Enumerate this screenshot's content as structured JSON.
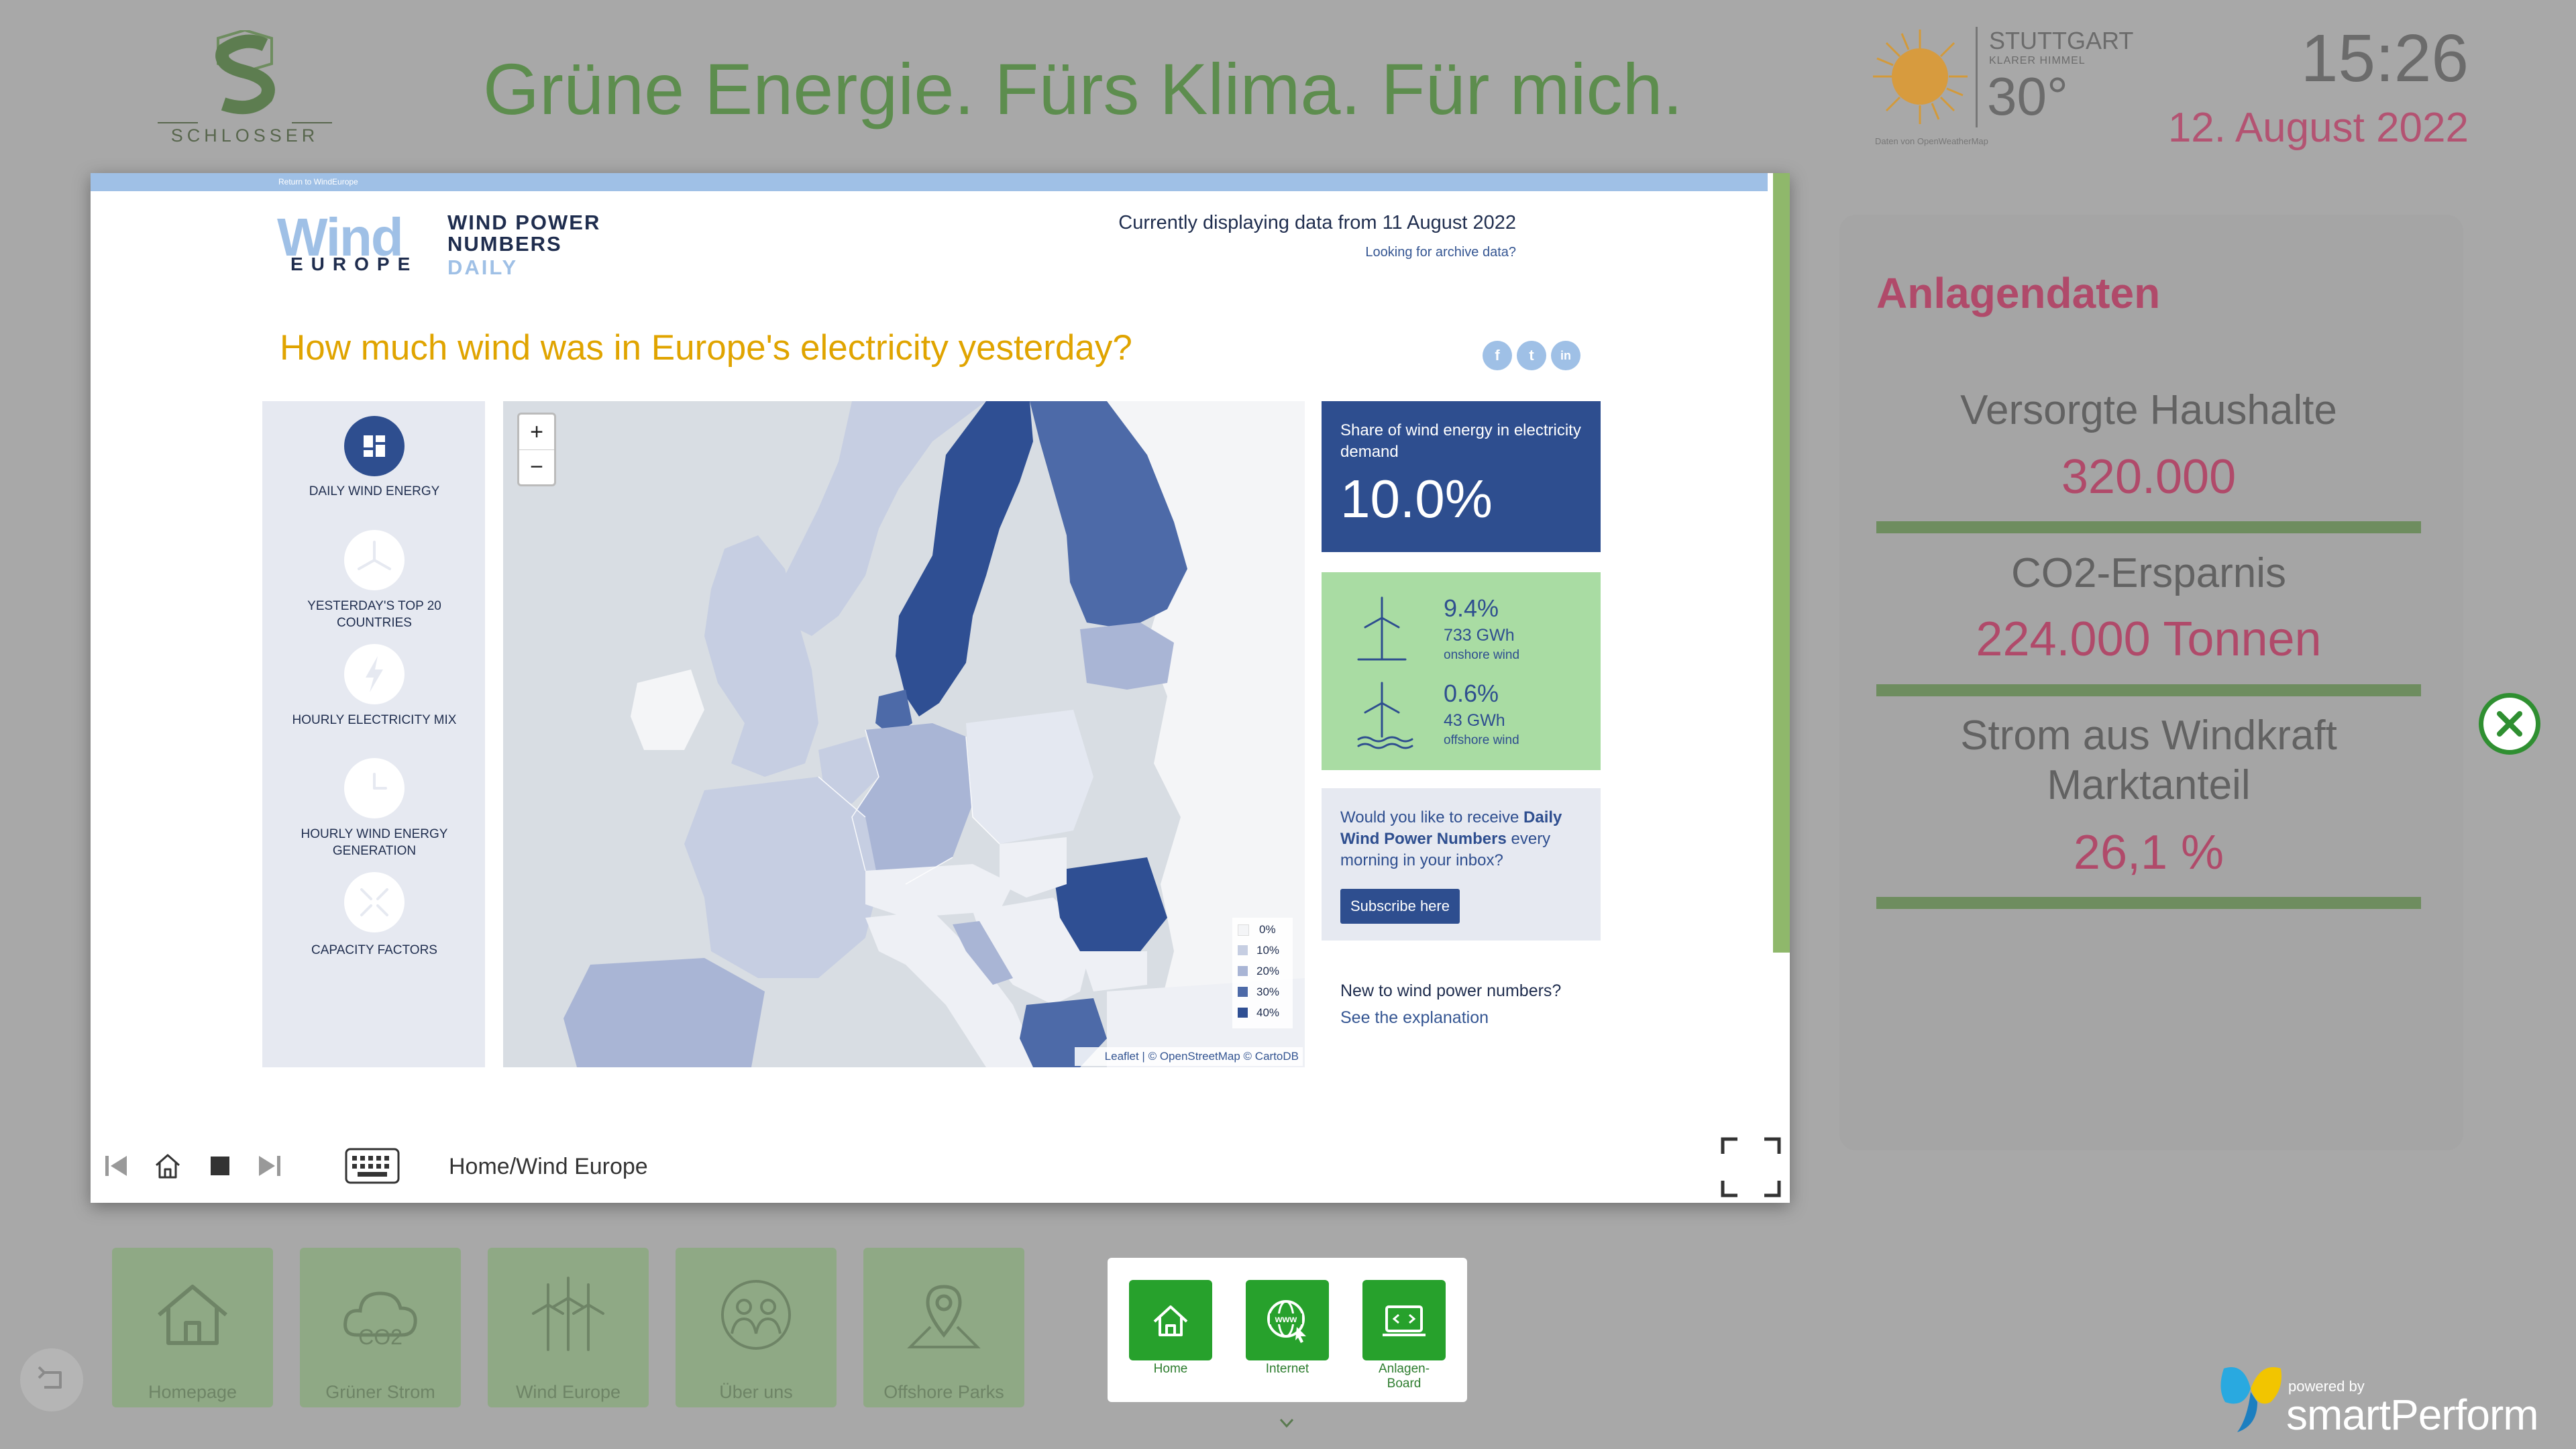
{
  "header": {
    "logo_text": "SCHLOSSER",
    "headline": "Grüne Energie. Fürs Klima. Für mich.",
    "weather": {
      "city": "STUTTGART",
      "condition": "KLARER HIMMEL",
      "temperature": "30°",
      "source": "Daten von OpenWeatherMap",
      "icon": "sun-icon"
    },
    "time": "15:26",
    "date": "12. August 2022"
  },
  "stats_panel": {
    "title": "Anlagendaten",
    "items": [
      {
        "label": "Versorgte Haushalte",
        "value": "320.000"
      },
      {
        "label": "CO2-Ersparnis",
        "value": "224.000 Tonnen"
      },
      {
        "label_line1": "Strom aus Windkraft",
        "label_line2": "Marktanteil",
        "value": "26,1 %"
      }
    ],
    "close_icon": "close-circle-icon"
  },
  "browser": {
    "return_link": "Return to WindEurope",
    "logo": {
      "wind": "Wind",
      "europe": "EUROPE"
    },
    "product": {
      "line1": "WIND POWER",
      "line2": "NUMBERS",
      "line3": "DAILY"
    },
    "current_data": "Currently displaying data from 11 August 2022",
    "archive_link": "Looking for archive data?",
    "question": "How much wind was in Europe's electricity yesterday?",
    "social": [
      "f",
      "t",
      "in"
    ],
    "sidebar": [
      {
        "label": "DAILY WIND ENERGY",
        "icon": "dashboard-icon"
      },
      {
        "label_line1": "YESTERDAY'S TOP 20",
        "label_line2": "COUNTRIES",
        "icon": "turbine-icon"
      },
      {
        "label": "HOURLY ELECTRICITY MIX",
        "icon": "lightning-icon"
      },
      {
        "label_line1": "HOURLY WIND ENERGY",
        "label_line2": "GENERATION",
        "icon": "clock-icon"
      },
      {
        "label": "CAPACITY FACTORS",
        "icon": "arrows-icon"
      }
    ],
    "map": {
      "zoom_in": "+",
      "zoom_out": "−",
      "legend": [
        "0%",
        "10%",
        "20%",
        "30%",
        "40%"
      ],
      "attribution_leaflet": "Leaflet",
      "attribution_rest": " | © OpenStreetMap © CartoDB"
    },
    "share": {
      "label": "Share of wind energy in electricity demand",
      "value": "10.0%"
    },
    "onshore": {
      "pct": "9.4%",
      "gwh": "733 GWh",
      "kind": "onshore wind"
    },
    "offshore": {
      "pct": "0.6%",
      "gwh": "43 GWh",
      "kind": "offshore wind"
    },
    "subscribe": {
      "text_pre": "Would you like to receive ",
      "text_bold": "Daily Wind Power Numbers",
      "text_post": " every morning in your inbox?",
      "button": "Subscribe here"
    },
    "new_to": "New to wind power numbers?",
    "see_explanation": "See the explanation",
    "controls": {
      "breadcrumb_home": "Home",
      "breadcrumb_sep": "/",
      "breadcrumb_page": "Wind Europe"
    }
  },
  "bottom_tiles": [
    {
      "label": "Homepage",
      "icon": "house-icon"
    },
    {
      "label": "Grüner Strom",
      "icon": "co2-cloud-icon"
    },
    {
      "label": "Wind Europe",
      "icon": "wind-turbines-icon"
    },
    {
      "label": "Über uns",
      "icon": "team-icon"
    },
    {
      "label": "Offshore Parks",
      "icon": "map-pin-icon"
    }
  ],
  "quick_buttons": [
    {
      "label": "Home",
      "icon": "home-icon"
    },
    {
      "label": "Internet",
      "icon": "globe-www-icon"
    },
    {
      "label": "Anlagen-Board",
      "icon": "code-monitor-icon"
    }
  ],
  "branding": {
    "powered_by": "powered by",
    "name": "smartPerform"
  },
  "colors": {
    "accent_green": "#27a12c",
    "brand_blue": "#2e4e8f",
    "magenta": "#b04a6a",
    "map_dark": "#2f4f93",
    "question_yellow": "#e0a400"
  }
}
